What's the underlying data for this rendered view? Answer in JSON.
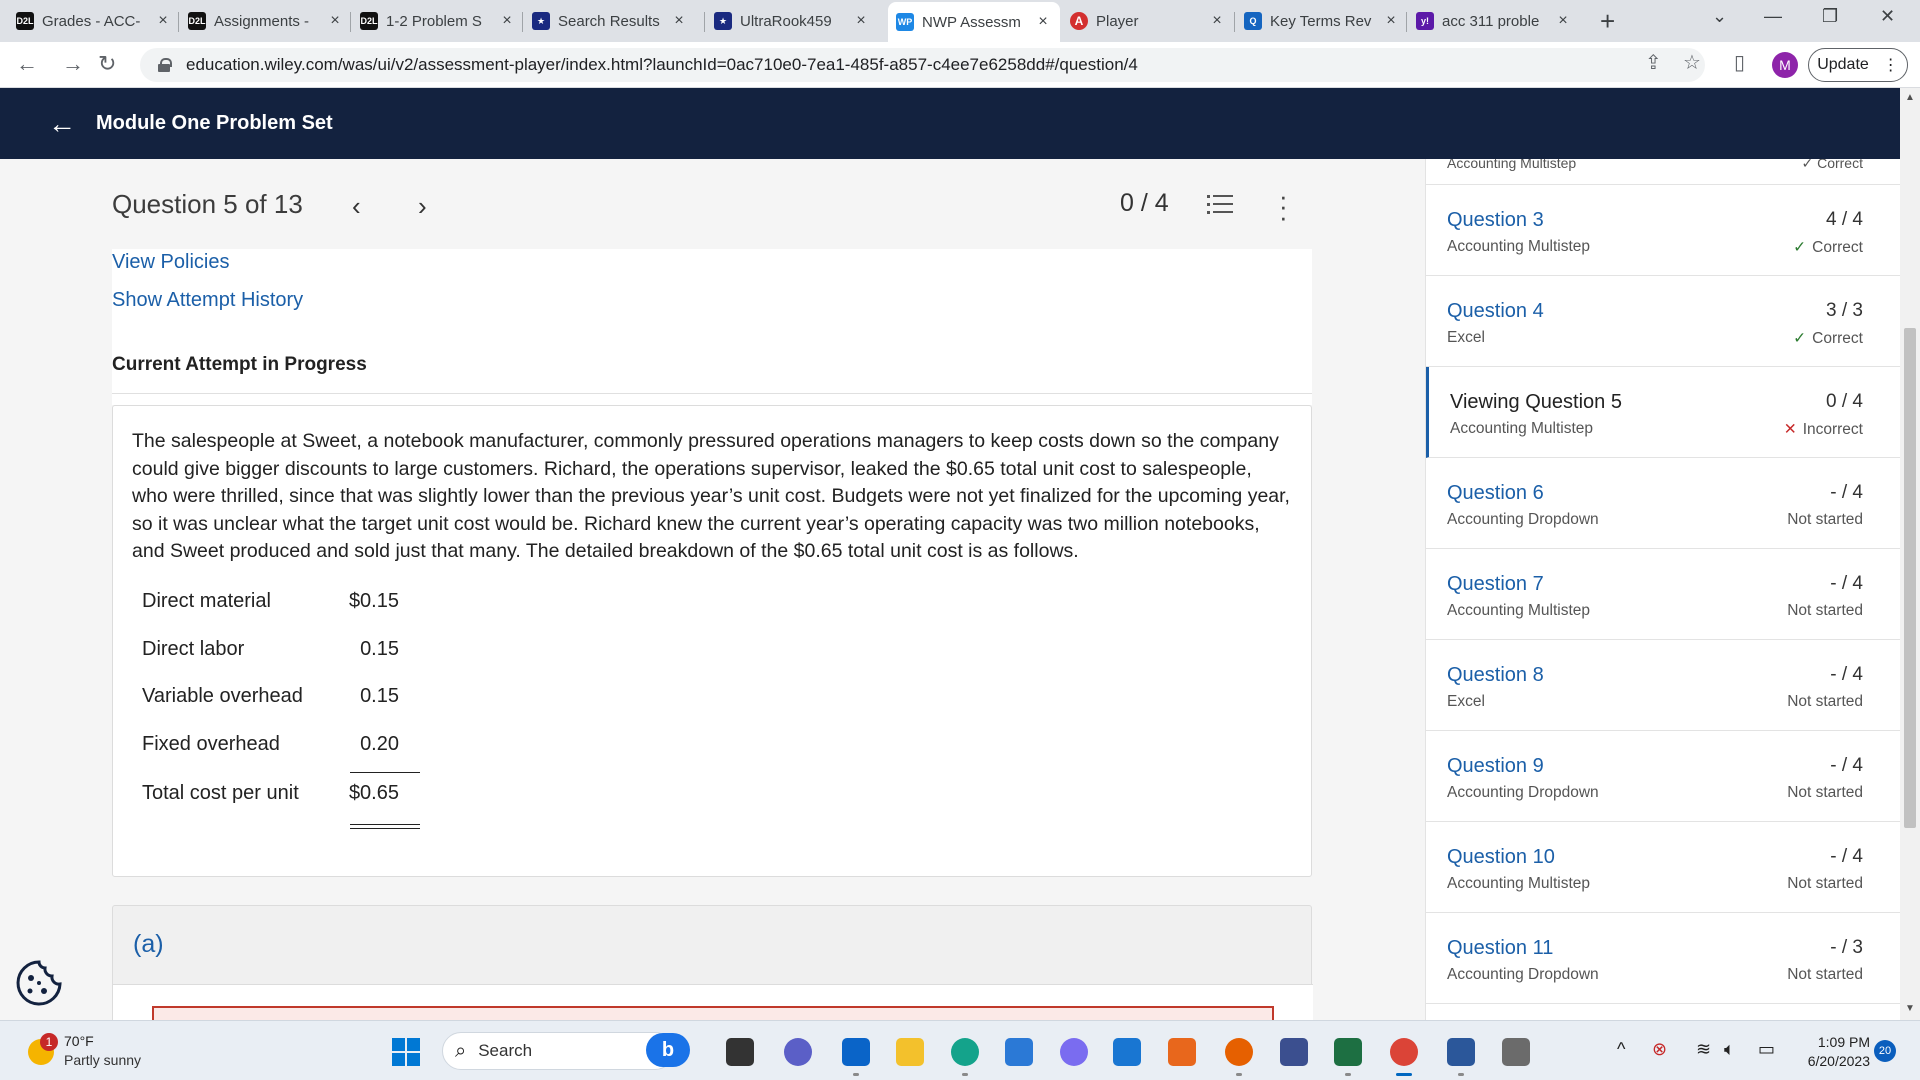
{
  "browser": {
    "tabs": [
      {
        "label": "Grades - ACC-",
        "fav": "D2L",
        "color": "#111111"
      },
      {
        "label": "Assignments -",
        "fav": "D2L",
        "color": "#111111"
      },
      {
        "label": "1-2 Problem S",
        "fav": "D2L",
        "color": "#111111"
      },
      {
        "label": "Search Results",
        "fav": "★",
        "color": "#1a2a80"
      },
      {
        "label": "UltraRook459",
        "fav": "★",
        "color": "#1a2a80"
      },
      {
        "label": "NWP Assessm",
        "fav": "WP",
        "color": "#1e88e5"
      },
      {
        "label": "Player",
        "fav": "A",
        "color": "#d32f2f"
      },
      {
        "label": "Key Terms Rev",
        "fav": "Q",
        "color": "#1565c0"
      },
      {
        "label": "acc 311 proble",
        "fav": "y!",
        "color": "#5c19a8"
      }
    ],
    "url": "education.wiley.com/was/ui/v2/assessment-player/index.html?launchId=0ac710e0-7ea1-485f-a857-c4ee7e6258dd#/question/4",
    "profile_initial": "M",
    "update_label": "Update"
  },
  "header": {
    "title": "Module One Problem Set"
  },
  "question": {
    "position": "Question 5 of 13",
    "score": "0 / 4",
    "view_policies": "View Policies",
    "attempt_history": "Show Attempt History",
    "attempt_status": "Current Attempt in Progress",
    "text": "The salespeople at Sweet, a notebook manufacturer, commonly pressured operations managers to keep costs down so the company could give bigger discounts to large customers. Richard, the operations supervisor, leaked the $0.65 total unit cost to salespeople, who were thrilled, since that was slightly lower than the previous year’s unit cost. Budgets were not yet finalized for the upcoming year, so it was unclear what the target unit cost would be. Richard knew the current year’s operating capacity was two million notebooks, and Sweet produced and sold just that many. The detailed breakdown of the $0.65 total unit cost is as follows.",
    "cost_table": [
      {
        "label": "Direct material",
        "value": "$0.15"
      },
      {
        "label": "Direct labor",
        "value": "0.15"
      },
      {
        "label": "Variable overhead",
        "value": "0.15"
      },
      {
        "label": "Fixed overhead",
        "value": "0.20"
      },
      {
        "label": "Total cost per unit",
        "value": "$0.65"
      }
    ],
    "part_label": "(a)"
  },
  "sidebar": {
    "top_partial_left": "Accounting Multistep",
    "top_partial_right": "✓ Correct",
    "items": [
      {
        "title": "Question 3",
        "type": "Accounting Multistep",
        "score": "4 / 4",
        "status": "Correct",
        "mark": "✓",
        "state": "ok"
      },
      {
        "title": "Question 4",
        "type": "Excel",
        "score": "3 / 3",
        "status": "Correct",
        "mark": "✓",
        "state": "ok"
      },
      {
        "title": "Viewing Question 5",
        "type": "Accounting Multistep",
        "score": "0 / 4",
        "status": "Incorrect",
        "mark": "✕",
        "state": "bad"
      },
      {
        "title": "Question 6",
        "type": "Accounting Dropdown",
        "score": "- / 4",
        "status": "Not started",
        "mark": "",
        "state": "none"
      },
      {
        "title": "Question 7",
        "type": "Accounting Multistep",
        "score": "- / 4",
        "status": "Not started",
        "mark": "",
        "state": "none"
      },
      {
        "title": "Question 8",
        "type": "Excel",
        "score": "- / 4",
        "status": "Not started",
        "mark": "",
        "state": "none"
      },
      {
        "title": "Question 9",
        "type": "Accounting Dropdown",
        "score": "- / 4",
        "status": "Not started",
        "mark": "",
        "state": "none"
      },
      {
        "title": "Question 10",
        "type": "Accounting Multistep",
        "score": "- / 4",
        "status": "Not started",
        "mark": "",
        "state": "none"
      },
      {
        "title": "Question 11",
        "type": "Accounting Dropdown",
        "score": "- / 3",
        "status": "Not started",
        "mark": "",
        "state": "none"
      }
    ]
  },
  "taskbar": {
    "weather_badge": "1",
    "temperature": "70°F",
    "condition": "Partly sunny",
    "search_label": "Search",
    "time": "1:09 PM",
    "date": "6/20/2023",
    "notifications": "20",
    "apps": [
      {
        "name": "file-explorer-dark-icon",
        "color": "#333333"
      },
      {
        "name": "teams-icon",
        "color": "#5b5fc7"
      },
      {
        "name": "outlook-icon",
        "color": "#0a64c8"
      },
      {
        "name": "folder-icon",
        "color": "#f3c12c"
      },
      {
        "name": "edge-icon",
        "color": "#14a38b"
      },
      {
        "name": "store-icon",
        "color": "#2b79d6"
      },
      {
        "name": "copilot-icon",
        "color": "#7a6cf0"
      },
      {
        "name": "cortana-icon",
        "color": "#1976d2"
      },
      {
        "name": "office-icon",
        "color": "#e8671c"
      },
      {
        "name": "firefox-icon",
        "color": "#e66000"
      },
      {
        "name": "snip-icon",
        "color": "#3b4f8f"
      },
      {
        "name": "excel-icon",
        "color": "#1d6f42"
      },
      {
        "name": "chrome-icon",
        "color": "#db4437"
      },
      {
        "name": "word-icon",
        "color": "#2b579a"
      },
      {
        "name": "calculator-icon",
        "color": "#6b6b6b"
      }
    ]
  }
}
